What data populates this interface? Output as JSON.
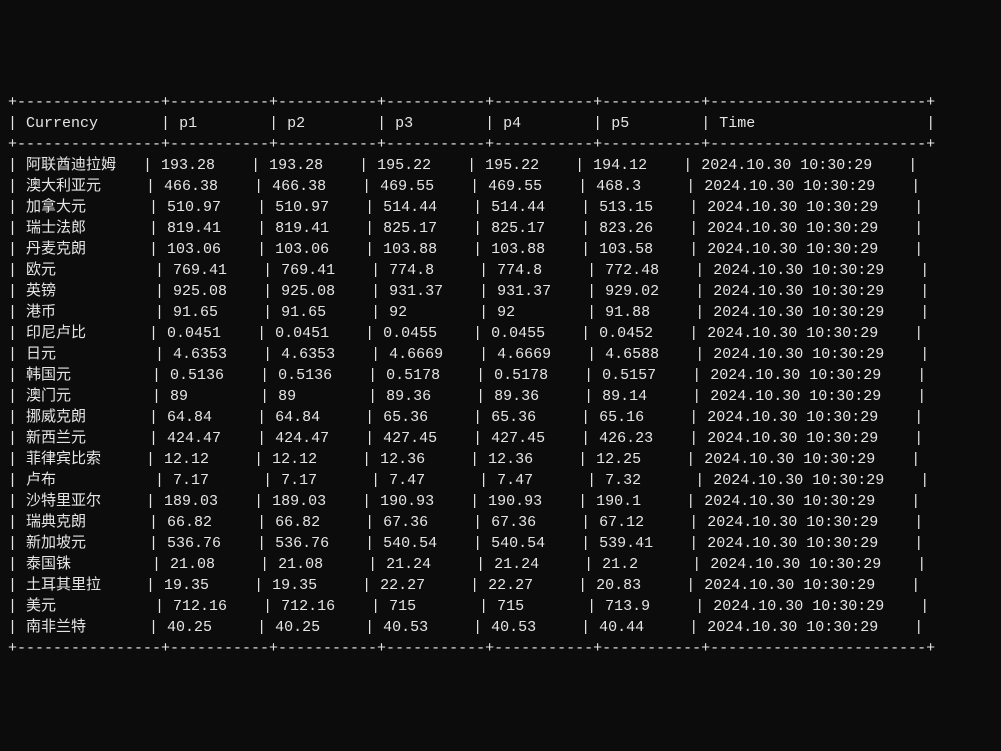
{
  "headers": [
    "Currency",
    "p1",
    "p2",
    "p3",
    "p4",
    "p5",
    "Time"
  ],
  "rows": [
    {
      "currency": "阿联酋迪拉姆",
      "p1": "193.28",
      "p2": "193.28",
      "p3": "195.22",
      "p4": "195.22",
      "p5": "194.12",
      "time": "2024.10.30 10:30:29"
    },
    {
      "currency": "澳大利亚元",
      "p1": "466.38",
      "p2": "466.38",
      "p3": "469.55",
      "p4": "469.55",
      "p5": "468.3",
      "time": "2024.10.30 10:30:29"
    },
    {
      "currency": "加拿大元",
      "p1": "510.97",
      "p2": "510.97",
      "p3": "514.44",
      "p4": "514.44",
      "p5": "513.15",
      "time": "2024.10.30 10:30:29"
    },
    {
      "currency": "瑞士法郎",
      "p1": "819.41",
      "p2": "819.41",
      "p3": "825.17",
      "p4": "825.17",
      "p5": "823.26",
      "time": "2024.10.30 10:30:29"
    },
    {
      "currency": "丹麦克朗",
      "p1": "103.06",
      "p2": "103.06",
      "p3": "103.88",
      "p4": "103.88",
      "p5": "103.58",
      "time": "2024.10.30 10:30:29"
    },
    {
      "currency": "欧元",
      "p1": "769.41",
      "p2": "769.41",
      "p3": "774.8",
      "p4": "774.8",
      "p5": "772.48",
      "time": "2024.10.30 10:30:29"
    },
    {
      "currency": "英镑",
      "p1": "925.08",
      "p2": "925.08",
      "p3": "931.37",
      "p4": "931.37",
      "p5": "929.02",
      "time": "2024.10.30 10:30:29"
    },
    {
      "currency": "港币",
      "p1": "91.65",
      "p2": "91.65",
      "p3": "92",
      "p4": "92",
      "p5": "91.88",
      "time": "2024.10.30 10:30:29"
    },
    {
      "currency": "印尼卢比",
      "p1": "0.0451",
      "p2": "0.0451",
      "p3": "0.0455",
      "p4": "0.0455",
      "p5": "0.0452",
      "time": "2024.10.30 10:30:29"
    },
    {
      "currency": "日元",
      "p1": "4.6353",
      "p2": "4.6353",
      "p3": "4.6669",
      "p4": "4.6669",
      "p5": "4.6588",
      "time": "2024.10.30 10:30:29"
    },
    {
      "currency": "韩国元",
      "p1": "0.5136",
      "p2": "0.5136",
      "p3": "0.5178",
      "p4": "0.5178",
      "p5": "0.5157",
      "time": "2024.10.30 10:30:29"
    },
    {
      "currency": "澳门元",
      "p1": "89",
      "p2": "89",
      "p3": "89.36",
      "p4": "89.36",
      "p5": "89.14",
      "time": "2024.10.30 10:30:29"
    },
    {
      "currency": "挪威克朗",
      "p1": "64.84",
      "p2": "64.84",
      "p3": "65.36",
      "p4": "65.36",
      "p5": "65.16",
      "time": "2024.10.30 10:30:29"
    },
    {
      "currency": "新西兰元",
      "p1": "424.47",
      "p2": "424.47",
      "p3": "427.45",
      "p4": "427.45",
      "p5": "426.23",
      "time": "2024.10.30 10:30:29"
    },
    {
      "currency": "菲律宾比索",
      "p1": "12.12",
      "p2": "12.12",
      "p3": "12.36",
      "p4": "12.36",
      "p5": "12.25",
      "time": "2024.10.30 10:30:29"
    },
    {
      "currency": "卢布",
      "p1": "7.17",
      "p2": "7.17",
      "p3": "7.47",
      "p4": "7.47",
      "p5": "7.32",
      "time": "2024.10.30 10:30:29"
    },
    {
      "currency": "沙特里亚尔",
      "p1": "189.03",
      "p2": "189.03",
      "p3": "190.93",
      "p4": "190.93",
      "p5": "190.1",
      "time": "2024.10.30 10:30:29"
    },
    {
      "currency": "瑞典克朗",
      "p1": "66.82",
      "p2": "66.82",
      "p3": "67.36",
      "p4": "67.36",
      "p5": "67.12",
      "time": "2024.10.30 10:30:29"
    },
    {
      "currency": "新加坡元",
      "p1": "536.76",
      "p2": "536.76",
      "p3": "540.54",
      "p4": "540.54",
      "p5": "539.41",
      "time": "2024.10.30 10:30:29"
    },
    {
      "currency": "泰国铢",
      "p1": "21.08",
      "p2": "21.08",
      "p3": "21.24",
      "p4": "21.24",
      "p5": "21.2",
      "time": "2024.10.30 10:30:29"
    },
    {
      "currency": "土耳其里拉",
      "p1": "19.35",
      "p2": "19.35",
      "p3": "22.27",
      "p4": "22.27",
      "p5": "20.83",
      "time": "2024.10.30 10:30:29"
    },
    {
      "currency": "美元",
      "p1": "712.16",
      "p2": "712.16",
      "p3": "715",
      "p4": "715",
      "p5": "713.9",
      "time": "2024.10.30 10:30:29"
    },
    {
      "currency": "南非兰特",
      "p1": "40.25",
      "p2": "40.25",
      "p3": "40.53",
      "p4": "40.53",
      "p5": "40.44",
      "time": "2024.10.30 10:30:29"
    }
  ],
  "col_widths_chars": [
    14,
    9,
    9,
    9,
    9,
    9,
    22
  ]
}
